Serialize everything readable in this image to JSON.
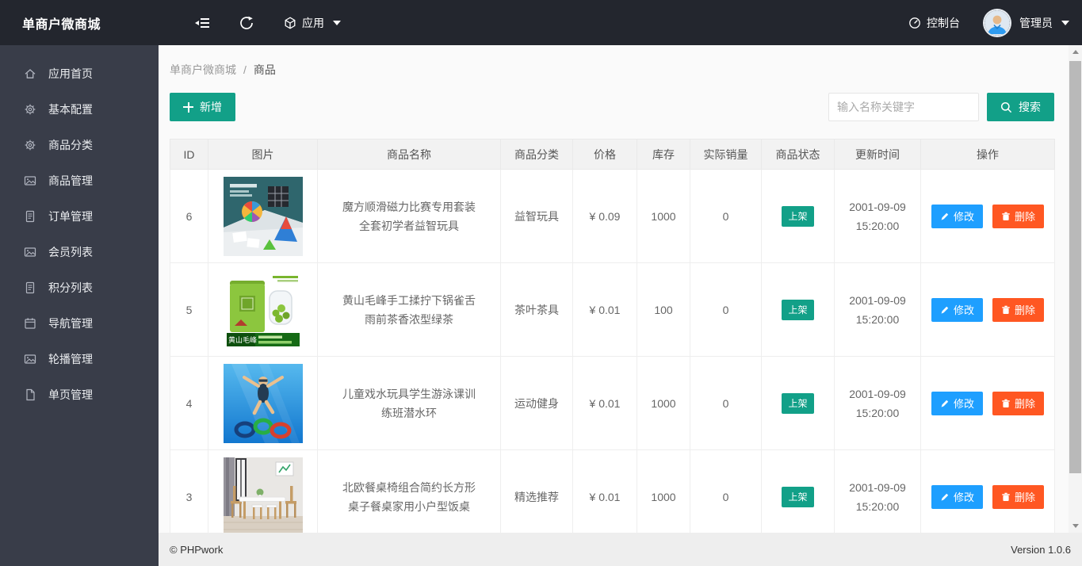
{
  "navbar": {
    "title": "单商户微商城",
    "app_menu": "应用",
    "console": "控制台",
    "user": "管理员"
  },
  "sidebar": {
    "items": [
      {
        "label": "应用首页",
        "icon": "home-icon"
      },
      {
        "label": "基本配置",
        "icon": "gear-icon"
      },
      {
        "label": "商品分类",
        "icon": "gear-icon"
      },
      {
        "label": "商品管理",
        "icon": "image-icon"
      },
      {
        "label": "订单管理",
        "icon": "document-icon"
      },
      {
        "label": "会员列表",
        "icon": "image-icon"
      },
      {
        "label": "积分列表",
        "icon": "document-icon"
      },
      {
        "label": "导航管理",
        "icon": "calendar-icon"
      },
      {
        "label": "轮播管理",
        "icon": "image-icon"
      },
      {
        "label": "单页管理",
        "icon": "file-icon"
      }
    ]
  },
  "breadcrumb": {
    "root": "单商户微商城",
    "separator": "/",
    "current": "商品"
  },
  "toolbar": {
    "add_label": "新增",
    "search_placeholder": "输入名称关键字",
    "search_label": "搜索"
  },
  "table": {
    "headers": [
      "ID",
      "图片",
      "商品名称",
      "商品分类",
      "价格",
      "库存",
      "实际销量",
      "商品状态",
      "更新时间",
      "操作"
    ],
    "actions": {
      "edit": "修改",
      "delete": "删除"
    },
    "rows": [
      {
        "id": "6",
        "image": "rubiks-cube-set",
        "image_caption": "",
        "name": "魔方顺滑磁力比赛专用套装全套初学者益智玩具",
        "category": "益智玩具",
        "price": "¥ 0.09",
        "stock": "1000",
        "sales": "0",
        "status": "上架",
        "date": "2001-09-09",
        "time": "15:20:00"
      },
      {
        "id": "5",
        "image": "green-tea-box",
        "image_caption": "黄山毛峰",
        "name": "黄山毛峰手工揉拧下锅雀舌雨前茶香浓型绿茶",
        "category": "茶叶茶具",
        "price": "¥ 0.01",
        "stock": "100",
        "sales": "0",
        "status": "上架",
        "date": "2001-09-09",
        "time": "15:20:00"
      },
      {
        "id": "4",
        "image": "swimming-dive-rings",
        "image_caption": "",
        "name": "儿童戏水玩具学生游泳课训练班潜水环",
        "category": "运动健身",
        "price": "¥ 0.01",
        "stock": "1000",
        "sales": "0",
        "status": "上架",
        "date": "2001-09-09",
        "time": "15:20:00"
      },
      {
        "id": "3",
        "image": "dining-table-set",
        "image_caption": "",
        "name": "北欧餐桌椅组合简约长方形桌子餐桌家用小户型饭桌",
        "category": "精选推荐",
        "price": "¥ 0.01",
        "stock": "1000",
        "sales": "0",
        "status": "上架",
        "date": "2001-09-09",
        "time": "15:20:00"
      }
    ]
  },
  "footer": {
    "copyright": "© PHPwork",
    "version": "Version 1.0.6"
  },
  "colors": {
    "accent_teal": "#12a088",
    "edit_blue": "#1e9fff",
    "delete_orange": "#ff5722",
    "header_bg": "#23262e",
    "sidebar_bg": "#393d49",
    "footer_bg": "#eeeeee",
    "table_header_bg": "#f2f2f2"
  }
}
